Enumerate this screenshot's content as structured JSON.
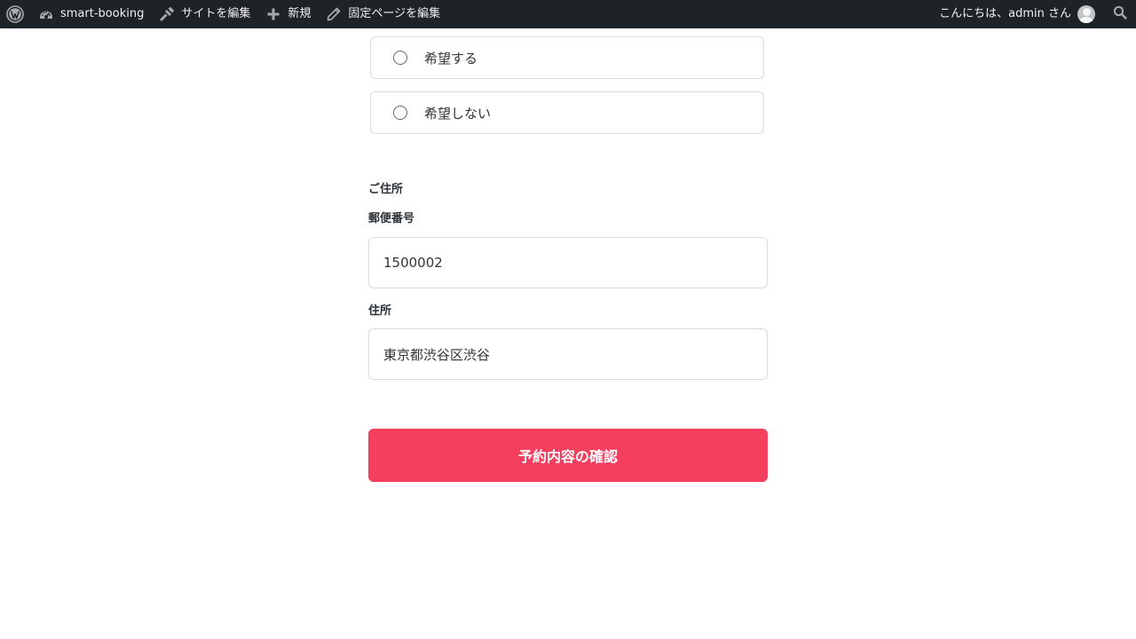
{
  "adminbar": {
    "site_name": "smart-booking",
    "edit_site": "サイトを編集",
    "new": "新規",
    "edit_page": "固定ページを編集",
    "greeting": "こんにちは、admin さん",
    "colors": {
      "background": "#1d2327",
      "text": "#f0f0f1"
    }
  },
  "form": {
    "radio_options": [
      {
        "label": "希望する",
        "checked": false
      },
      {
        "label": "希望しない",
        "checked": false
      }
    ],
    "address_section_title": "ご住所",
    "postal_code_label": "郵便番号",
    "postal_code_value": "1500002",
    "address_label": "住所",
    "address_value": "東京都渋谷区渋谷",
    "submit_label": "予約内容の確認",
    "colors": {
      "submit": "#f43f5e"
    }
  }
}
